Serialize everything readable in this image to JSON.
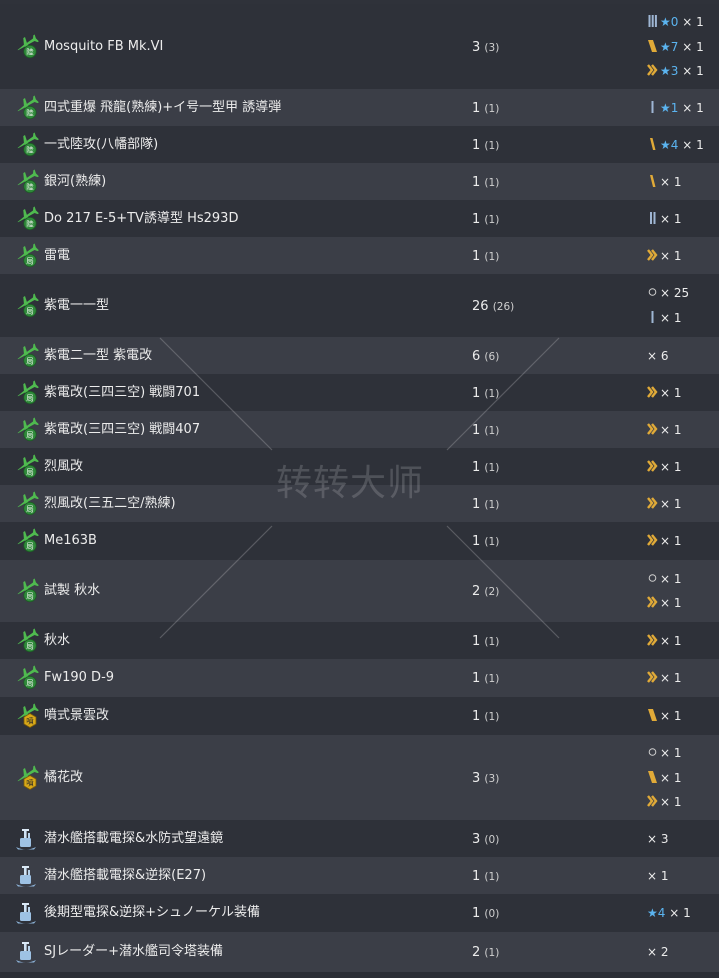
{
  "colors": {
    "row_dark": "#2e3139",
    "row_light": "#3b3e47",
    "star": "#5bb4f0",
    "prof_gold": "#e0aa38",
    "plane_green": "#4fba4f",
    "badge_green": "#2f8a3a",
    "badge_yellow": "#d8a818"
  },
  "watermark": "转转大师",
  "rows": [
    {
      "name": "Mosquito FB Mk.VI",
      "icon": "land-bomber-icon",
      "count": "3",
      "count_sub": "(3)",
      "lines": [
        {
          "mark": "prof-bars-3",
          "star": "★0",
          "qty": "× 1"
        },
        {
          "mark": "prof-double-slash",
          "star": "★7",
          "qty": "× 1"
        },
        {
          "mark": "prof-chevron",
          "star": "★3",
          "qty": "× 1"
        }
      ]
    },
    {
      "name": "四式重爆 飛龍(熟練)+イ号一型甲 誘導弾",
      "icon": "land-bomber-icon",
      "count": "1",
      "count_sub": "(1)",
      "lines": [
        {
          "mark": "prof-bar-1",
          "star": "★1",
          "qty": "× 1"
        }
      ]
    },
    {
      "name": "一式陸攻(八幡部隊)",
      "icon": "land-bomber-icon",
      "count": "1",
      "count_sub": "(1)",
      "lines": [
        {
          "mark": "prof-slash",
          "star": "★4",
          "qty": "× 1"
        }
      ]
    },
    {
      "name": "銀河(熟練)",
      "icon": "land-bomber-icon",
      "count": "1",
      "count_sub": "(1)",
      "lines": [
        {
          "mark": "prof-slash",
          "star": "",
          "qty": "× 1"
        }
      ]
    },
    {
      "name": "Do 217 E-5+TV誘導型 Hs293D",
      "icon": "land-bomber-icon",
      "count": "1",
      "count_sub": "(1)",
      "lines": [
        {
          "mark": "prof-bars-2",
          "star": "",
          "qty": "× 1"
        }
      ]
    },
    {
      "name": "雷電",
      "icon": "interceptor-icon",
      "count": "1",
      "count_sub": "(1)",
      "lines": [
        {
          "mark": "prof-chevron",
          "star": "",
          "qty": "× 1"
        }
      ]
    },
    {
      "name": "紫電一一型",
      "icon": "interceptor-icon",
      "count": "26",
      "count_sub": "(26)",
      "lines": [
        {
          "mark": "circle",
          "star": "",
          "qty": "× 25"
        },
        {
          "mark": "prof-bar-1",
          "star": "",
          "qty": "× 1"
        }
      ]
    },
    {
      "name": "紫電二一型 紫電改",
      "icon": "interceptor-icon",
      "count": "6",
      "count_sub": "(6)",
      "lines": [
        {
          "mark": "none",
          "star": "",
          "qty": "× 6"
        }
      ]
    },
    {
      "name": "紫電改(三四三空) 戦闘701",
      "icon": "interceptor-icon",
      "count": "1",
      "count_sub": "(1)",
      "lines": [
        {
          "mark": "prof-chevron",
          "star": "",
          "qty": "× 1"
        }
      ]
    },
    {
      "name": "紫電改(三四三空) 戦闘407",
      "icon": "interceptor-icon",
      "count": "1",
      "count_sub": "(1)",
      "lines": [
        {
          "mark": "prof-chevron",
          "star": "",
          "qty": "× 1"
        }
      ]
    },
    {
      "name": "烈風改",
      "icon": "interceptor-icon",
      "count": "1",
      "count_sub": "(1)",
      "lines": [
        {
          "mark": "prof-chevron",
          "star": "",
          "qty": "× 1"
        }
      ]
    },
    {
      "name": "烈風改(三五二空/熟練)",
      "icon": "interceptor-icon",
      "count": "1",
      "count_sub": "(1)",
      "lines": [
        {
          "mark": "prof-chevron",
          "star": "",
          "qty": "× 1"
        }
      ]
    },
    {
      "name": "Me163B",
      "icon": "interceptor-icon",
      "count": "1",
      "count_sub": "(1)",
      "lines": [
        {
          "mark": "prof-chevron",
          "star": "",
          "qty": "× 1"
        }
      ]
    },
    {
      "name": "試製 秋水",
      "icon": "interceptor-icon",
      "count": "2",
      "count_sub": "(2)",
      "lines": [
        {
          "mark": "circle",
          "star": "",
          "qty": "× 1"
        },
        {
          "mark": "prof-chevron",
          "star": "",
          "qty": "× 1"
        }
      ]
    },
    {
      "name": "秋水",
      "icon": "interceptor-icon",
      "count": "1",
      "count_sub": "(1)",
      "lines": [
        {
          "mark": "prof-chevron",
          "star": "",
          "qty": "× 1"
        }
      ]
    },
    {
      "name": "Fw190 D-9",
      "icon": "interceptor-icon",
      "count": "1",
      "count_sub": "(1)",
      "lines": [
        {
          "mark": "prof-chevron",
          "star": "",
          "qty": "× 1"
        }
      ]
    },
    {
      "name": "噴式景雲改",
      "icon": "jet-bomber-icon",
      "count": "1",
      "count_sub": "(1)",
      "lines": [
        {
          "mark": "prof-double-slash",
          "star": "",
          "qty": "× 1"
        }
      ]
    },
    {
      "name": "橘花改",
      "icon": "jet-bomber-icon",
      "count": "3",
      "count_sub": "(3)",
      "lines": [
        {
          "mark": "circle",
          "star": "",
          "qty": "× 1"
        },
        {
          "mark": "prof-double-slash",
          "star": "",
          "qty": "× 1"
        },
        {
          "mark": "prof-chevron",
          "star": "",
          "qty": "× 1"
        }
      ]
    },
    {
      "name": "潜水艦搭載電探&水防式望遠鏡",
      "icon": "submarine-radar-icon",
      "count": "3",
      "count_sub": "(0)",
      "lines": [
        {
          "mark": "none",
          "star": "",
          "qty": "× 3"
        }
      ]
    },
    {
      "name": "潜水艦搭載電探&逆探(E27)",
      "icon": "submarine-radar-icon",
      "count": "1",
      "count_sub": "(1)",
      "lines": [
        {
          "mark": "none",
          "star": "",
          "qty": "× 1"
        }
      ]
    },
    {
      "name": "後期型電探&逆探+シュノーケル装備",
      "icon": "submarine-radar-icon",
      "count": "1",
      "count_sub": "(0)",
      "lines": [
        {
          "mark": "none",
          "star": "★4",
          "qty": "× 1"
        }
      ]
    },
    {
      "name": "SJレーダー+潜水艦司令塔装備",
      "icon": "submarine-radar-icon",
      "count": "2",
      "count_sub": "(1)",
      "lines": [
        {
          "mark": "none",
          "star": "",
          "qty": "× 2"
        }
      ]
    }
  ]
}
